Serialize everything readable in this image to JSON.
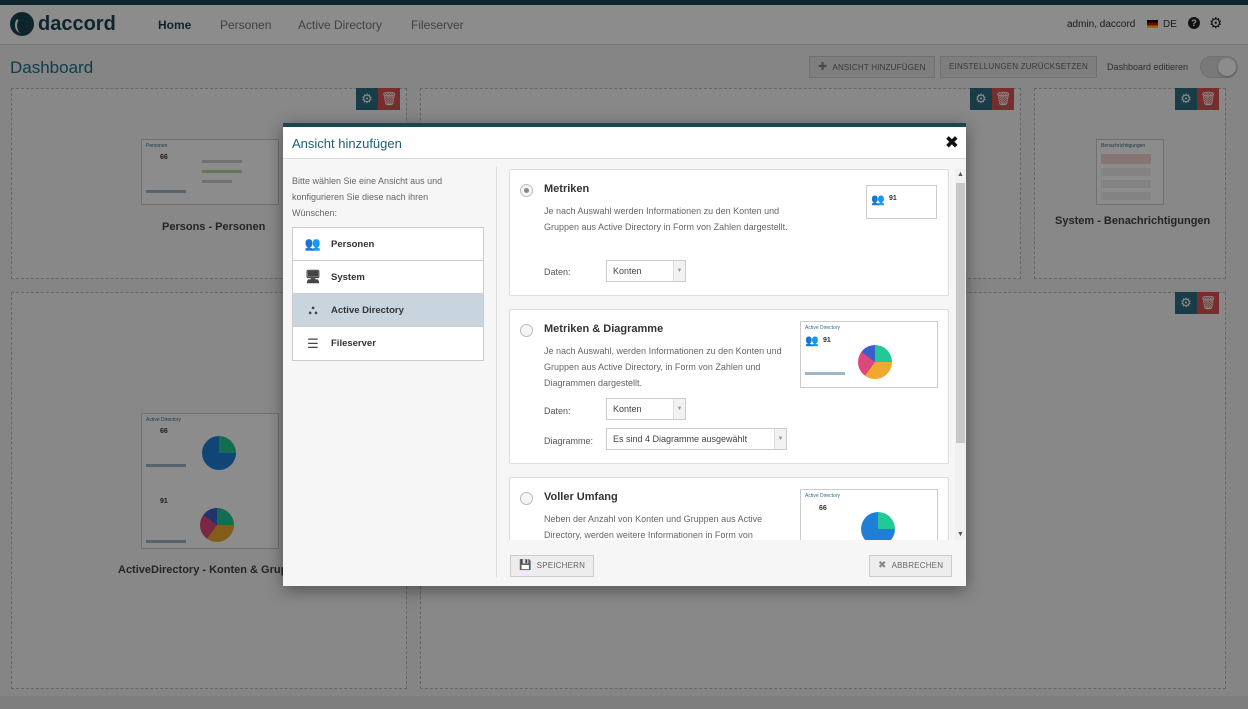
{
  "app": {
    "logo_text": "daccord"
  },
  "nav": {
    "items": [
      "Home",
      "Personen",
      "Active Directory",
      "Fileserver"
    ],
    "user": "admin, daccord",
    "lang": "DE"
  },
  "dashboard": {
    "title": "Dashboard",
    "add_view_label": "ANSICHT HINZUFÜGEN",
    "reset_label": "EINSTELLUNGEN ZURÜCKSETZEN",
    "edit_label": "Dashboard editieren",
    "widgets": [
      {
        "label": "Persons - Personen",
        "thumb_title": "Personen",
        "value": "66"
      },
      {
        "label": "System - Benachrichtigungen",
        "thumb_title": "Benachrichtigungen"
      },
      {
        "label": "ActiveDirectory - Konten & Grupp",
        "thumb_title": "Active Directory",
        "value1": "66",
        "value2": "91"
      }
    ]
  },
  "modal": {
    "title": "Ansicht hinzufügen",
    "intro": "Bitte wählen Sie eine Ansicht aus und konfigurieren Sie diese nach ihren Wünschen:",
    "categories": [
      "Personen",
      "System",
      "Active Directory",
      "Fileserver"
    ],
    "selected_category": "Active Directory",
    "options": [
      {
        "title": "Metriken",
        "desc": "Je nach Auswahl werden Informationen zu den Konten und Gruppen aus Active Directory in Form von Zahlen dargestellt.",
        "daten_label": "Daten:",
        "daten_value": "Konten",
        "thumb_value": "91",
        "selected": true
      },
      {
        "title": "Metriken & Diagramme",
        "desc": "Je nach Auswahl, werden Informationen zu den Konten und Gruppen aus Active Directory, in Form von Zahlen und Diagrammen dargestellt.",
        "daten_label": "Daten:",
        "daten_value": "Konten",
        "diagramme_label": "Diagramme:",
        "diagramme_value": "Es sind 4 Diagramme ausgewählt",
        "thumb_title": "Active Directory",
        "thumb_value": "91"
      },
      {
        "title": "Voller Umfang",
        "desc": "Neben der Anzahl von Konten und Gruppen aus Active Directory, werden weitere Informationen in Form von",
        "thumb_title": "Active Directory",
        "thumb_value": "66"
      }
    ],
    "save_label": "SPEICHERN",
    "cancel_label": "ABBRECHEN"
  },
  "colors": {
    "brand": "#1c4452",
    "accent": "#1c6f8a",
    "delete": "#d9534f",
    "settings": "#2f6f84"
  }
}
